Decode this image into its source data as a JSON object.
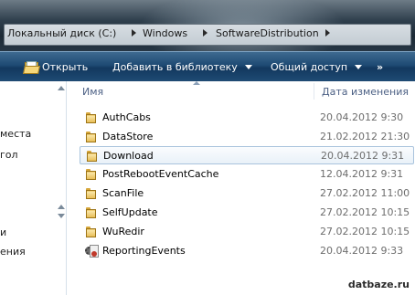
{
  "address_bar": {
    "crumbs": [
      "Локальный диск (C:)",
      "Windows",
      "SoftwareDistribution"
    ]
  },
  "toolbar": {
    "open_label": "Открыть",
    "add_to_library_label": "Добавить в библиотеку",
    "share_label": "Общий доступ",
    "more_label": "»"
  },
  "nav_pane": {
    "items": [
      "места",
      "гол",
      "",
      "и",
      "ения"
    ]
  },
  "file_list": {
    "columns": {
      "name": "Имя",
      "date_modified": "Дата изменения"
    },
    "rows": [
      {
        "name": "AuthCabs",
        "date": "20.04.2012 9:30",
        "icon": "folder-icon"
      },
      {
        "name": "DataStore",
        "date": "21.02.2012 21:30",
        "icon": "folder-icon"
      },
      {
        "name": "Download",
        "date": "20.04.2012 9:31",
        "icon": "folder-icon",
        "selected": true
      },
      {
        "name": "PostRebootEventCache",
        "date": "12.04.2012 9:31",
        "icon": "folder-icon"
      },
      {
        "name": "ScanFile",
        "date": "27.02.2012 11:00",
        "icon": "folder-icon"
      },
      {
        "name": "SelfUpdate",
        "date": "27.02.2012 10:15",
        "icon": "folder-icon"
      },
      {
        "name": "WuRedir",
        "date": "27.02.2012 10:15",
        "icon": "folder-icon"
      },
      {
        "name": "ReportingEvents",
        "date": "20.04.2012 9:33",
        "icon": "event-log-icon"
      }
    ]
  },
  "watermark": "datbaze.ru",
  "colors": {
    "toolbar_bg": "#1e4a73",
    "header_text": "#4d6185",
    "selection_border": "#a9c3dd"
  }
}
